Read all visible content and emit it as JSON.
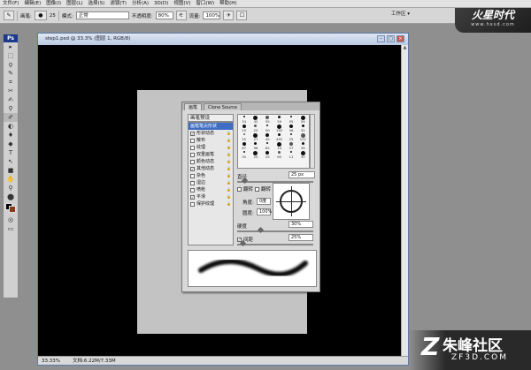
{
  "menu": [
    "文件(F)",
    "编辑(E)",
    "图像(I)",
    "图层(L)",
    "选择(S)",
    "滤镜(T)",
    "分析(A)",
    "3D(D)",
    "视图(V)",
    "窗口(W)",
    "帮助(H)"
  ],
  "options": {
    "brush_label": "画笔:",
    "brush_size": "25",
    "mode_label": "模式:",
    "mode_value": "正常",
    "opacity_label": "不透明度:",
    "opacity_value": "80%",
    "flow_label": "流量:",
    "flow_value": "100%",
    "workspace_label": "工作区 ▾"
  },
  "watermark": {
    "title": "火星时代",
    "url": "www.hxsd.com"
  },
  "toolbox": {
    "logo": "Ps",
    "tools": [
      "▸",
      "⬚",
      "ϙ",
      "✎",
      "⌗",
      "✂",
      "✍",
      "⚲",
      "✐",
      "◐",
      "♦",
      "◆",
      "T",
      "↖",
      "■",
      "✋",
      "⚲",
      "⬤"
    ]
  },
  "document": {
    "title": "step1.psd @ 33.3% (图层 1, RGB/8)",
    "zoom": "33.33%",
    "doc_info": "文档:6.22M/7.33M"
  },
  "brush_panel": {
    "tabs": [
      "画笔",
      "Clone Source"
    ],
    "preset_label": "画笔预设",
    "options": [
      {
        "label": "画笔笔尖形状",
        "checked": false,
        "selected": true
      },
      {
        "label": "形状动态",
        "checked": true,
        "selected": false
      },
      {
        "label": "散布",
        "checked": false,
        "selected": false
      },
      {
        "label": "纹理",
        "checked": false,
        "selected": false
      },
      {
        "label": "双重画笔",
        "checked": false,
        "selected": false
      },
      {
        "label": "颜色动态",
        "checked": false,
        "selected": false
      },
      {
        "label": "其他动态",
        "checked": true,
        "selected": false
      },
      {
        "label": "杂色",
        "checked": false,
        "selected": false
      },
      {
        "label": "湿边",
        "checked": false,
        "selected": false
      },
      {
        "label": "喷枪",
        "checked": false,
        "selected": false
      },
      {
        "label": "平滑",
        "checked": true,
        "selected": false
      },
      {
        "label": "保护纹理",
        "checked": false,
        "selected": false
      }
    ],
    "tips": [
      "34",
      "42",
      "55",
      "59",
      "55",
      "59",
      "25",
      "25",
      "50",
      "192",
      "36",
      "32",
      "25",
      "27",
      "45",
      "492",
      "25",
      "122",
      "67",
      "98",
      "62",
      "14",
      "27",
      "36",
      "30",
      "20",
      "25",
      "60",
      "11",
      "30"
    ],
    "diameter_label": "直径",
    "diameter_value": "25 px",
    "flip_x": "翻转 X",
    "flip_y": "翻转 Y",
    "angle_label": "角度:",
    "angle_value": "0度",
    "roundness_label": "圆度:",
    "roundness_value": "100%",
    "hardness_label": "硬度",
    "hardness_value": "30%",
    "spacing_label": "间距",
    "spacing_value": "25%"
  },
  "bottom_logo": {
    "cn": "朱峰社区",
    "en": "ZF3D.COM",
    "mark": "Z"
  },
  "colors": {
    "foreground": "#000000",
    "background": "#8a3a1a",
    "selection": "#3d6dc4"
  }
}
